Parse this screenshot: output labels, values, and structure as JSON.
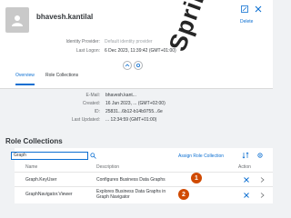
{
  "user": {
    "name": "bhavesh.kantilal",
    "delete_label": "Delete"
  },
  "summary": {
    "identity_provider_label": "Identity Provider:",
    "identity_provider_value": "Default identity provider",
    "last_logon_label": "Last Logon:",
    "last_logon_value": "6 Dec 2023, 11:39:42 (GMT+01:00)"
  },
  "tabs": [
    {
      "label": "Overview",
      "active": true
    },
    {
      "label": "Role Collections",
      "active": false
    }
  ],
  "details": {
    "email_label": "E-Mail:",
    "email_value": "bhavesh.kant...",
    "created_label": "Created:",
    "created_value": "16 Jun 2023, ... (GMT+02:00)",
    "id_label": "ID:",
    "id_value": "25831...6b12-b14b9755...6e",
    "last_updated_label": "Last Updated:",
    "last_updated_value": "... 12:34:59 (GMT+01:00)"
  },
  "role_collections": {
    "title": "Role Collections",
    "search_value": "Graph",
    "assign_label": "Assign Role Collection",
    "columns": {
      "name": "Name",
      "description": "Description",
      "action": "Action"
    },
    "rows": [
      {
        "name": "Graph.KeyUser",
        "description": "Configures Business Data Graphs",
        "callout": "1"
      },
      {
        "name": "GraphNavigator.Viewer",
        "description": "Explores Business Data Graphs in Graph Navigator",
        "callout": "2"
      }
    ]
  },
  "watermark": "Springegrate",
  "colors": {
    "accent": "#0a6ed1",
    "callout": "#d04a02"
  },
  "icons": [
    "user-icon",
    "edit-icon",
    "close-icon",
    "collapse-icon",
    "pin-icon",
    "search-icon",
    "sort-icon",
    "settings-icon",
    "remove-icon",
    "chevron-right-icon"
  ]
}
